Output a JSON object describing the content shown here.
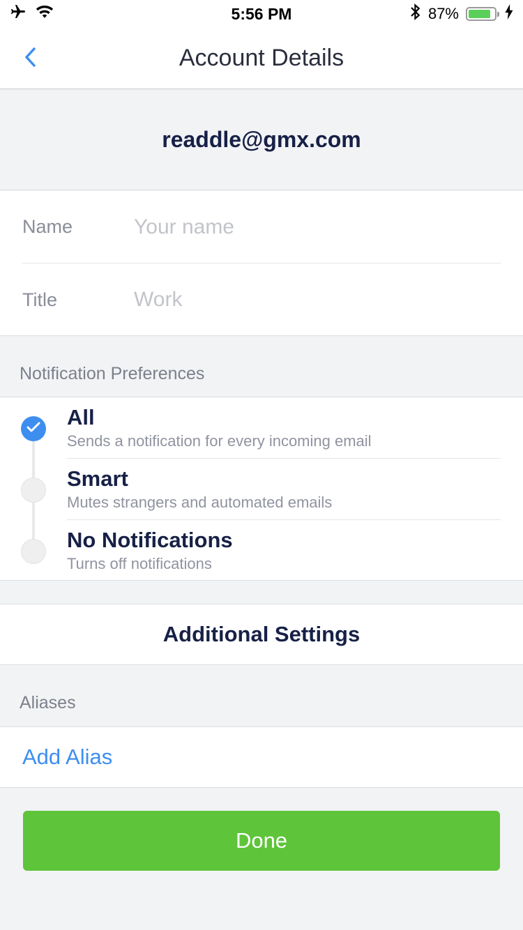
{
  "status_bar": {
    "time": "5:56 PM",
    "battery_percent": "87%",
    "battery_level": 0.87,
    "icons": [
      "airplane-icon",
      "wifi-icon",
      "bluetooth-icon",
      "battery-icon",
      "charging-bolt-icon"
    ]
  },
  "nav": {
    "title": "Account Details",
    "back_icon": "chevron-left-icon"
  },
  "account": {
    "email": "readdle@gmx.com"
  },
  "form": {
    "name_label": "Name",
    "name_placeholder": "Your name",
    "name_value": "",
    "title_label": "Title",
    "title_placeholder": "Work",
    "title_value": ""
  },
  "notifications": {
    "header": "Notification Preferences",
    "selected": "All",
    "options": [
      {
        "title": "All",
        "description": "Sends a notification for every incoming email"
      },
      {
        "title": "Smart",
        "description": "Mutes strangers and automated emails"
      },
      {
        "title": "No Notifications",
        "description": "Turns off notifications"
      }
    ]
  },
  "additional_settings": {
    "label": "Additional Settings"
  },
  "aliases": {
    "header": "Aliases",
    "add_label": "Add Alias"
  },
  "done": {
    "label": "Done"
  },
  "colors": {
    "accent_blue": "#3e8ef0",
    "done_green": "#5ec43a",
    "text_dark": "#172046"
  }
}
